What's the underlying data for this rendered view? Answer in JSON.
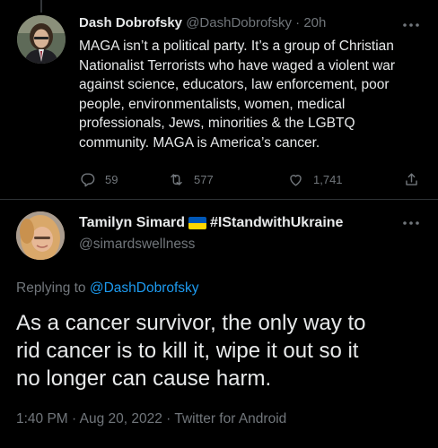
{
  "parent_tweet": {
    "display_name": "Dash Dobrofsky",
    "handle": "@DashDobrofsky",
    "separator": "·",
    "time": "20h",
    "text": "MAGA isn’t a political party. It’s a group of Christian\nNationalist Terrorists who have waged a violent war\nagainst science, educators, law enforcement, poor\npeople, environmentalists, women, medical\nprofessionals, Jews, minorities & the LGBTQ\ncommunity. MAGA is America’s cancer.",
    "replies": "59",
    "retweets": "577",
    "likes": "1,741",
    "icons": {
      "reply": "reply-icon",
      "retweet": "retweet-icon",
      "like": "like-icon",
      "share": "share-icon",
      "more": "more-icon"
    }
  },
  "main_tweet": {
    "display_name": "Tamilyn Simard",
    "flag": "ukraine-flag",
    "hashtag": "#IStandwithUkraine",
    "handle": "@simardswellness",
    "replying_prefix": "Replying to ",
    "replying_to": "@DashDobrofsky",
    "text": "As a cancer survivor, the only way to\nrid cancer is to kill it, wipe it out so it\nno longer can cause harm.",
    "timestamp": "1:40 PM · Aug 20, 2022 · Twitter for Android"
  },
  "colors": {
    "background": "#000000",
    "text": "#e7e9ea",
    "muted": "#71767b",
    "link": "#1d9bf0",
    "divider": "#2f3336"
  }
}
